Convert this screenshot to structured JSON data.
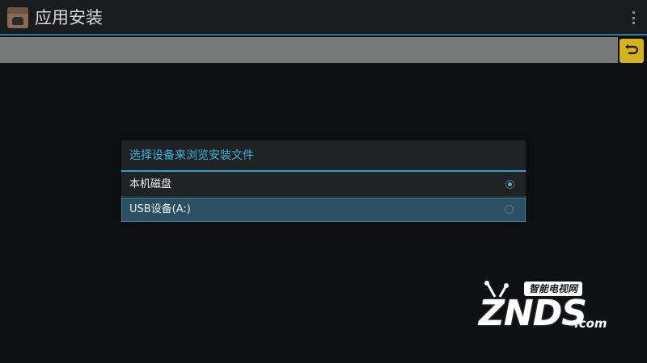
{
  "action_bar": {
    "title": "应用安装",
    "app_icon": "installer-icon",
    "overflow_icon": "overflow-menu-icon"
  },
  "path_bar": {
    "value": "",
    "back_icon": "back-arrow-icon",
    "back_color": "#d4b21e"
  },
  "dialog": {
    "title": "选择设备来浏览安装文件",
    "options": [
      {
        "label": "本机磁盘",
        "selected": true
      },
      {
        "label": "USB设备(A:)",
        "selected": false
      }
    ],
    "accent_color": "#35b5e5"
  },
  "watermark": {
    "tagline": "智能电视网",
    "brand": "ZNDS",
    "domain": ".com"
  }
}
